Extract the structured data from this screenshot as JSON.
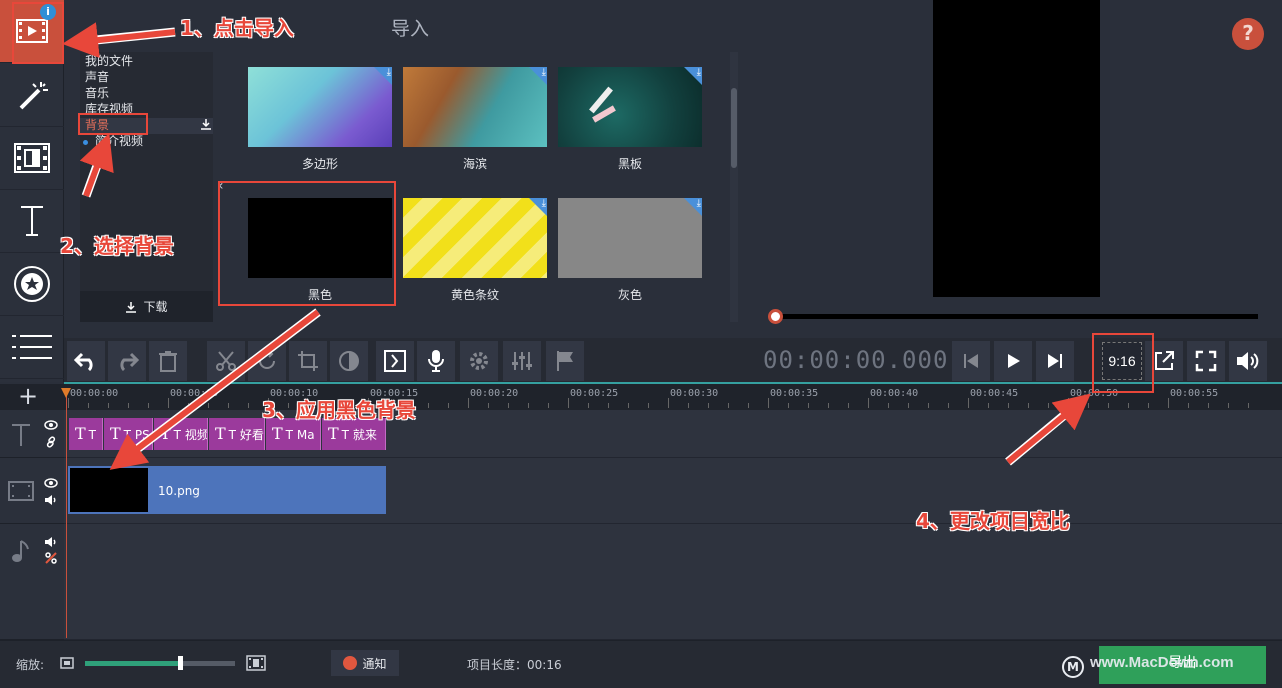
{
  "library": {
    "title": "导入",
    "categories": [
      "我的文件",
      "声音",
      "音乐",
      "库存视频",
      "背景",
      "简介视频"
    ],
    "download_label": "下载",
    "items": [
      {
        "label": "多边形"
      },
      {
        "label": "海滨"
      },
      {
        "label": "黑板"
      },
      {
        "label": "黑色"
      },
      {
        "label": "黄色条纹"
      },
      {
        "label": "灰色"
      }
    ]
  },
  "preview": {
    "help_label": "?",
    "timecode": "00:00:00.000",
    "aspect_ratio": "9:16"
  },
  "timeline": {
    "ruler": [
      "00:00:00",
      "00:00:05",
      "00:00:10",
      "00:00:15",
      "00:00:20",
      "00:00:25",
      "00:00:30",
      "00:00:35",
      "00:00:40",
      "00:00:45",
      "00:00:50",
      "00:00:55"
    ],
    "title_clips": [
      "",
      "PS",
      "视频",
      "好看",
      "Ma",
      "就来"
    ],
    "video_clip": "10.png"
  },
  "status": {
    "zoom_label": "缩放:",
    "zoom_level": 0.63,
    "notify_label": "通知",
    "duration_label": "项目长度：00:16",
    "export_label": "导出",
    "watermark": "www.MacDown.com"
  },
  "annotations": {
    "step1": "1、点击导入",
    "step2": "2、选择背景",
    "step3": "3、应用黑色背景",
    "step4": "4、更改项目宽比"
  },
  "colors": {
    "accent": "#c9503c",
    "annotation": "#e8473a",
    "export": "#2fa05a",
    "title_clip": "#9b3a9c",
    "video_clip": "#4d74bb"
  }
}
